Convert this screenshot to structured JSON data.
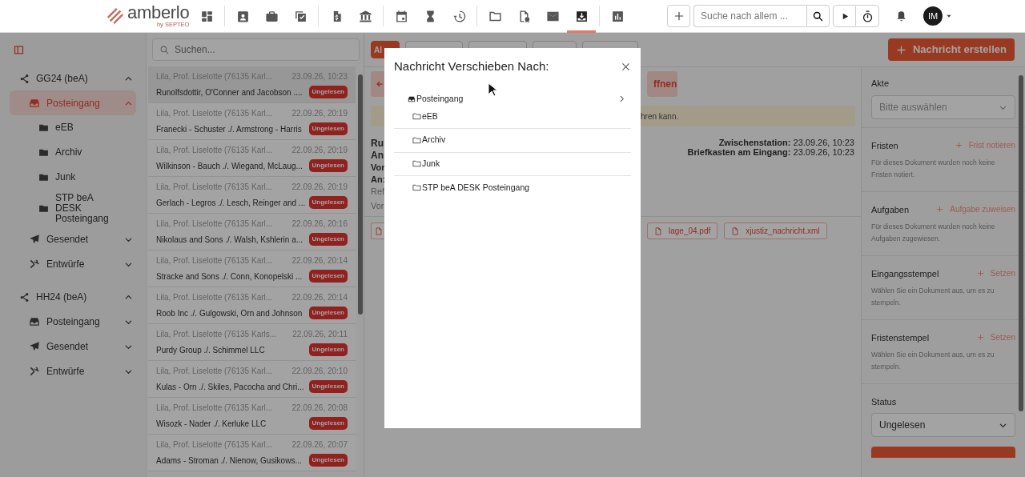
{
  "top_nav": {
    "logo": "amberlo",
    "logo_sub": "by SEPTEO",
    "nav_items": [
      {
        "kind": "dashboard",
        "selected": false,
        "divider_after": true
      },
      {
        "kind": "contact",
        "selected": false
      },
      {
        "kind": "briefcase",
        "selected": false
      },
      {
        "kind": "tasks",
        "selected": false,
        "divider_after": true
      },
      {
        "kind": "billing",
        "selected": false
      },
      {
        "kind": "bank",
        "selected": false,
        "divider_after": true
      },
      {
        "kind": "calendar",
        "selected": false
      },
      {
        "kind": "hourglass",
        "selected": false
      },
      {
        "kind": "history",
        "selected": false,
        "divider_after": true
      },
      {
        "kind": "folder",
        "selected": false
      },
      {
        "kind": "folder-badge",
        "selected": false
      },
      {
        "kind": "mail",
        "selected": false
      },
      {
        "kind": "inbox",
        "selected": true,
        "divider_after": true
      },
      {
        "kind": "chart",
        "selected": false
      }
    ],
    "search": {
      "placeholder": "Suche nach allem ..."
    },
    "avatar": "IM"
  },
  "sidebar": {
    "accounts": [
      {
        "name": "GG24 (beA)",
        "expanded": true,
        "folders": [
          {
            "label": "Posteingang",
            "kind": "inbox",
            "selected": true,
            "expanded": true,
            "children": [
              {
                "label": "eEB",
                "selected": false
              },
              {
                "label": "Archiv",
                "selected": false
              },
              {
                "label": "Junk",
                "selected": false
              },
              {
                "label": "STP beA DESK Posteingang",
                "selected": false
              }
            ]
          },
          {
            "label": "Gesendet",
            "kind": "sent",
            "selected": false,
            "expanded": false
          },
          {
            "label": "Entwürfe",
            "kind": "drafts",
            "selected": false,
            "expanded": false
          }
        ]
      },
      {
        "name": "HH24 (beA)",
        "expanded": true,
        "folders": [
          {
            "label": "Posteingang",
            "kind": "inbox",
            "selected": false,
            "expanded": false
          },
          {
            "label": "Gesendet",
            "kind": "sent",
            "selected": false,
            "expanded": false
          },
          {
            "label": "Entwürfe",
            "kind": "drafts",
            "selected": false,
            "expanded": false
          }
        ]
      }
    ]
  },
  "message_list": {
    "search": {
      "placeholder": "Suchen..."
    },
    "messages": [
      {
        "sender": "Lila, Prof. Liselotte (76135 Karl...",
        "date": "23.09.26, 10:23",
        "subject": "Runolfsdottir, O'Conner and Jacobson ....",
        "badge": "Ungelesen",
        "selected": true
      },
      {
        "sender": "Lila, Prof. Liselotte (76135 Karl...",
        "date": "22.09.26, 20:19",
        "subject": "Franecki - Schuster ./. Armstrong - Harris",
        "badge": "Ungelesen",
        "selected": false
      },
      {
        "sender": "Lila, Prof. Liselotte (76135 Karl...",
        "date": "22.09.26, 20:19",
        "subject": "Wilkinson - Bauch ./. Wiegand, McLaug...",
        "badge": "Ungelesen",
        "selected": false
      },
      {
        "sender": "Lila, Prof. Liselotte (76135 Karl...",
        "date": "22.09.26, 20:19",
        "subject": "Gerlach - Legros ./. Lesch, Reinger and ...",
        "badge": "Ungelesen",
        "selected": false
      },
      {
        "sender": "Lila, Prof. Liselotte (76135 Karl...",
        "date": "22.09.26, 20:16",
        "subject": "Nikolaus and Sons ./. Walsh, Kshlerin a...",
        "badge": "Ungelesen",
        "selected": false
      },
      {
        "sender": "Lila, Prof. Liselotte (76135 Karl...",
        "date": "22.09.26, 20:14",
        "subject": "Stracke and Sons ./. Conn, Konopelski ...",
        "badge": "Ungelesen",
        "selected": false
      },
      {
        "sender": "Lila, Prof. Liselotte (76135 Karl...",
        "date": "22.09.26, 20:14",
        "subject": "Roob Inc ./. Gulgowski, Orn and Johnson",
        "badge": "Ungelesen",
        "selected": false
      },
      {
        "sender": "Lila, Prof. Liselotte (76135 Karls...",
        "date": "22.09.26, 20:11",
        "subject": "Purdy Group ./. Schimmel LLC",
        "badge": "Ungelesen",
        "selected": false
      },
      {
        "sender": "Lila, Prof. Liselotte (76135 Karl...",
        "date": "22.09.26, 20:10",
        "subject": "Kulas - Orn ./. Skiles, Pacocha and Chri...",
        "badge": "Ungelesen",
        "selected": false
      },
      {
        "sender": "Lila, Prof. Liselotte (76135 Karl...",
        "date": "22.09.26, 20:08",
        "subject": "Wisozk - Nader ./. Kerluke LLC",
        "badge": "Ungelesen",
        "selected": false
      },
      {
        "sender": "Lila, Prof. Liselotte (76135 Karl...",
        "date": "22.09.26, 20:07",
        "subject": "Adams - Stroman ./. Nienow, Gusikows...",
        "badge": "Ungelesen",
        "selected": false
      }
    ]
  },
  "detail": {
    "filters": [
      {
        "label": "Al",
        "selected": true
      },
      {
        "selected": false
      },
      {
        "selected": false
      },
      {
        "selected": false
      },
      {
        "selected": false
      }
    ],
    "create_button": "Nachricht erstellen",
    "open_button": "ffnen",
    "notice": "hren kann.",
    "title_lines": [
      "Ru",
      "An"
    ],
    "fields": [
      {
        "text": "Vor",
        "kind": "bold"
      },
      {
        "text": "An:",
        "kind": "bold"
      },
      {
        "text": "Ref",
        "kind": "muted"
      },
      {
        "text": "Vor",
        "kind": "muted"
      }
    ],
    "timestamps": [
      {
        "label": "Zwischenstation:",
        "value": "23.09.26, 10:23"
      },
      {
        "label": "Briefkasten am Eingang:",
        "value": "23.09.26, 10:23"
      }
    ],
    "attachments": [
      "lage_04.pdf",
      "xjustiz_nachricht.xml"
    ]
  },
  "side_panel": {
    "akte": {
      "label": "Akte",
      "placeholder": "Bitte auswählen"
    },
    "sections": [
      {
        "title": "Fristen",
        "action": "Frist notieren",
        "text": "Für dieses Dokument wurden noch keine Fristen notiert."
      },
      {
        "title": "Aufgaben",
        "action": "Aufgabe zuweisen",
        "text": "Für dieses Dokument wurden noch keine Aufgaben zugewiesen."
      },
      {
        "title": "Eingangsstempel",
        "action": "Setzen",
        "text": "Wählen Sie ein Dokument aus, um es zu stempeln."
      },
      {
        "title": "Fristenstempel",
        "action": "Setzen",
        "text": "Wählen Sie ein Dokument aus, um es zu stempeln."
      }
    ],
    "status": {
      "label": "Status",
      "value": "Ungelesen"
    }
  },
  "modal": {
    "title": "Nachricht Verschieben Nach:",
    "tree": {
      "label": "Posteingang",
      "children": [
        {
          "label": "eEB"
        },
        {
          "label": "Archiv"
        },
        {
          "label": "Junk"
        },
        {
          "label": "STP beA DESK Posteingang"
        }
      ]
    }
  }
}
